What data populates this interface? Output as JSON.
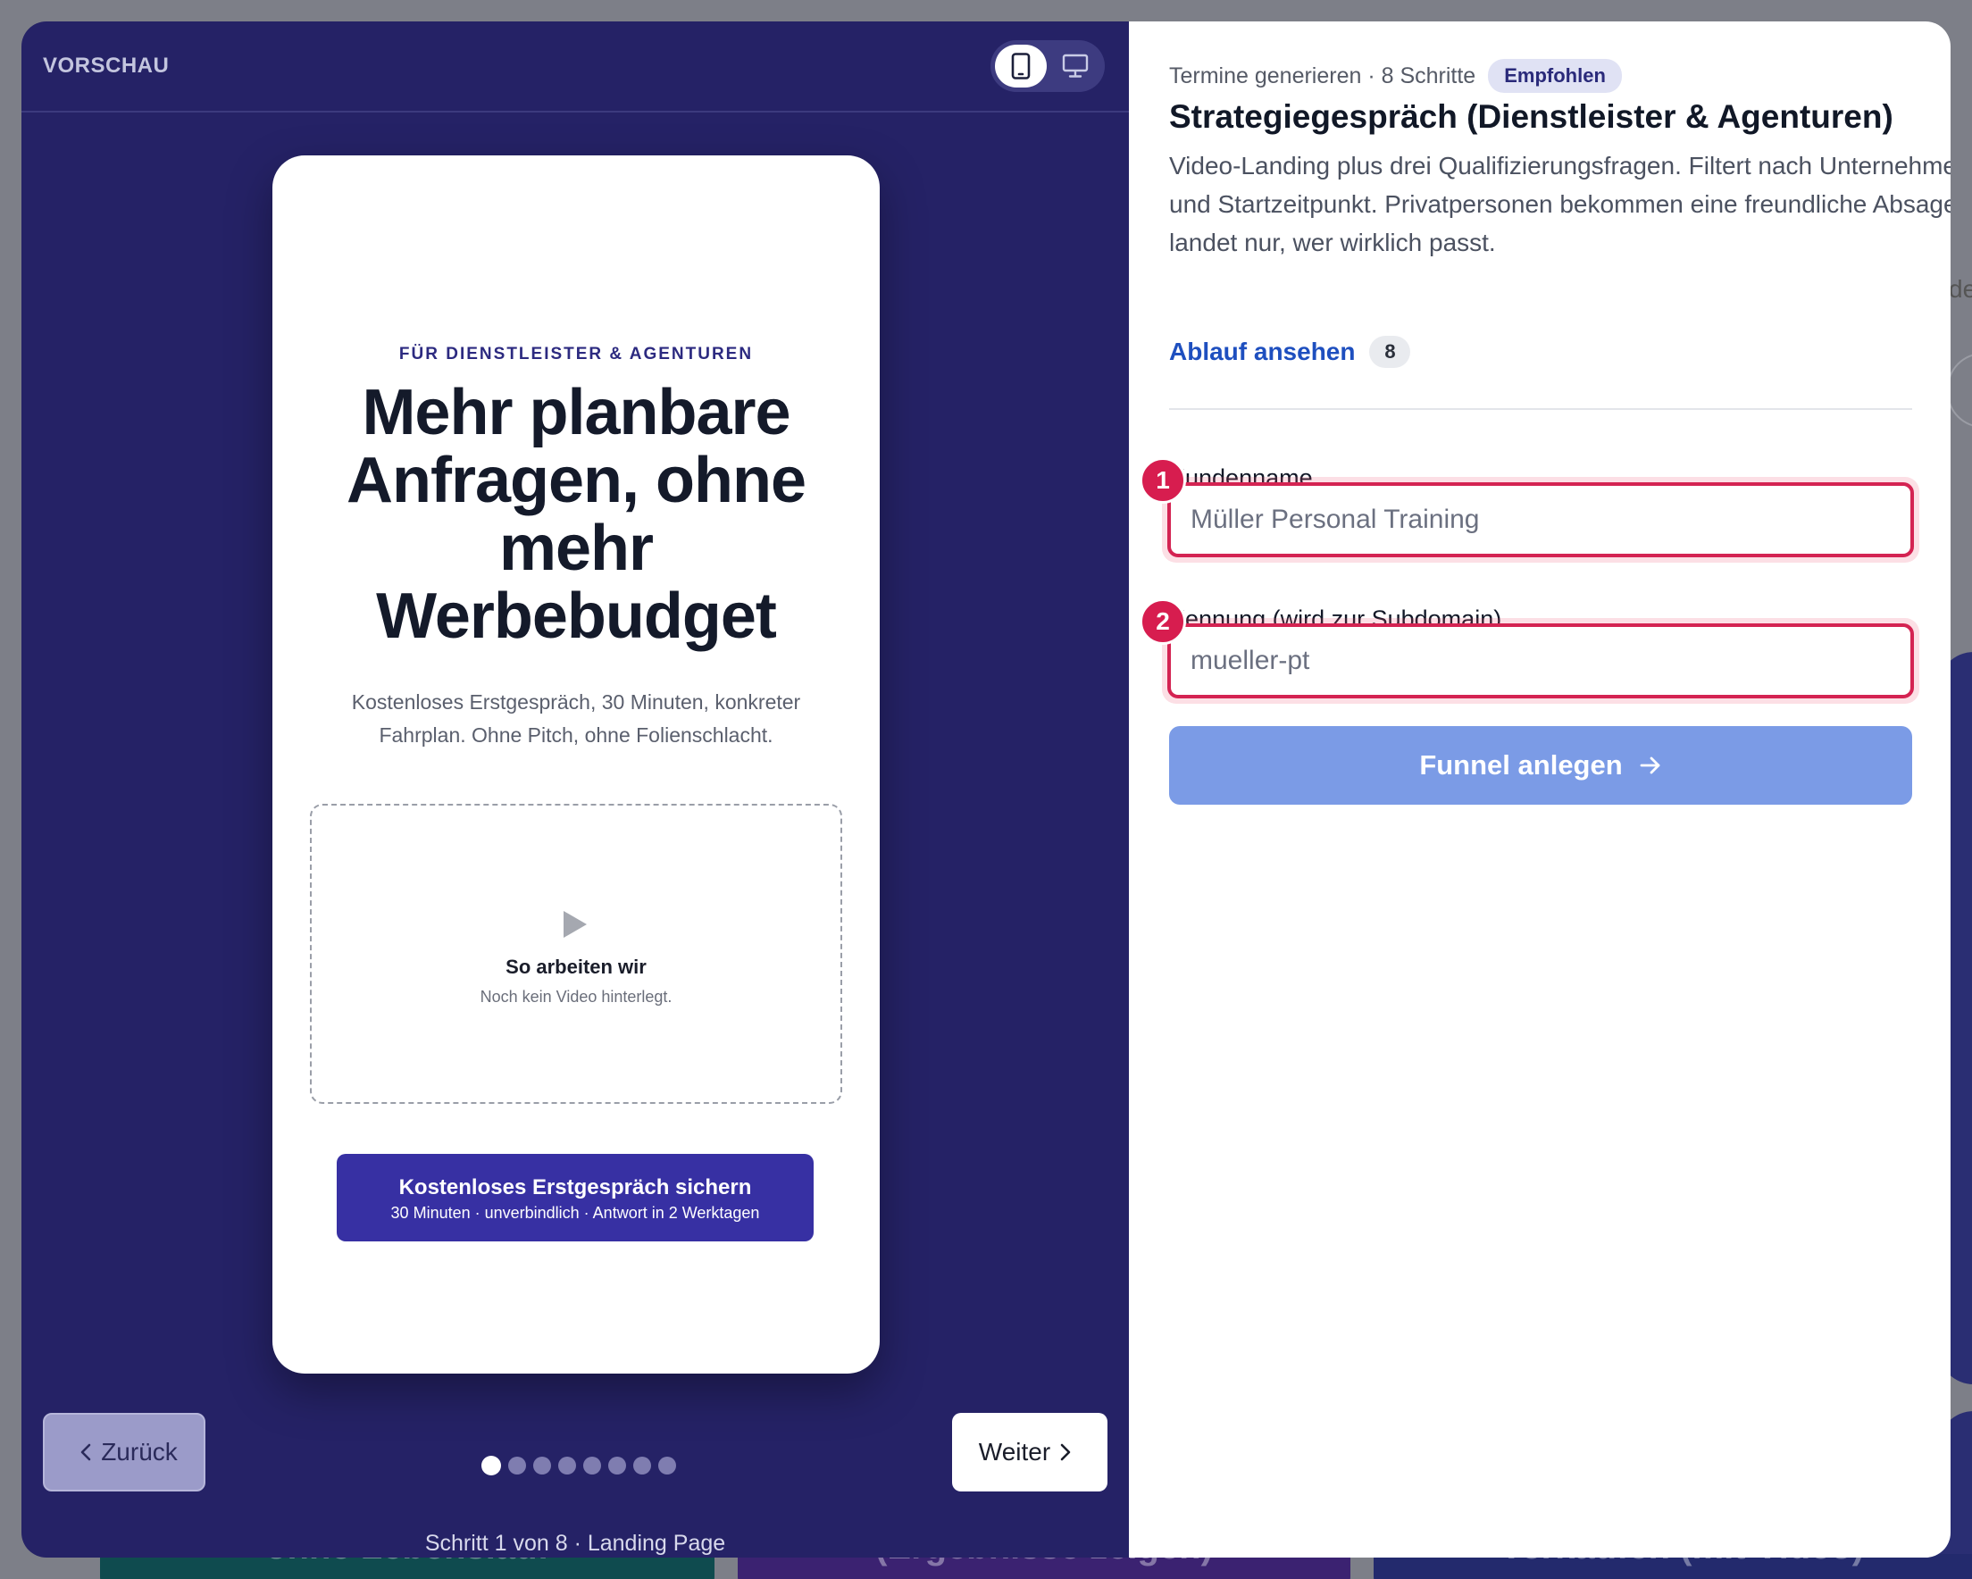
{
  "background": {
    "cards": [
      "ohne Lebenslauf",
      "(Ergebnisse zeigen)",
      "Verkaufen (mit Video)"
    ],
    "edge_text": "de"
  },
  "preview": {
    "title": "VORSCHAU",
    "device_toggle": {
      "mobile_icon": "smartphone-icon",
      "desktop_icon": "monitor-icon"
    },
    "phone": {
      "eyebrow": "FÜR DIENSTLEISTER & AGENTUREN",
      "headline": "Mehr planbare Anfragen, ohne mehr Werbebudget",
      "subtext": "Kostenloses Erstgespräch, 30 Minuten, konkreter Fahrplan. Ohne Pitch, ohne Folienschlacht.",
      "video": {
        "title": "So arbeiten wir",
        "subtitle": "Noch kein Video hinterlegt."
      },
      "cta": {
        "label": "Kostenloses Erstgespräch sichern",
        "sublabel": "30 Minuten · unverbindlich · Antwort in 2 Werktagen"
      }
    },
    "nav": {
      "back_label": "Zurück",
      "next_label": "Weiter",
      "steps_total": 8,
      "current_step": 1,
      "caption": "Schritt 1 von 8 · Landing Page"
    }
  },
  "details": {
    "meta": "Termine generieren · 8 Schritte",
    "badge": "Empfohlen",
    "title": "Strategiegespräch (Dienstleister & Agenturen)",
    "description": "Video-Landing plus drei Qualifizierungsfragen. Filtert nach Unternehmensgröße, Engpass und Startzeitpunkt. Privatpersonen bekommen eine freundliche Absage, im Kalender landet nur, wer wirklich passt.",
    "flow_link": {
      "label": "Ablauf ansehen",
      "count": "8"
    },
    "fields": [
      {
        "number": "1",
        "label": "Kundenname",
        "value": "",
        "placeholder": "Müller Personal Training"
      },
      {
        "number": "2",
        "label": "Kennung (wird zur Subdomain)",
        "value": "",
        "placeholder": "mueller-pt"
      }
    ],
    "submit_label": "Funnel anlegen"
  },
  "colors": {
    "preview_bg": "#252266",
    "cta_bg": "#3730a3",
    "error_red": "#d42352",
    "submit_bg": "#7b9be6",
    "link_blue": "#1e4fbf"
  }
}
